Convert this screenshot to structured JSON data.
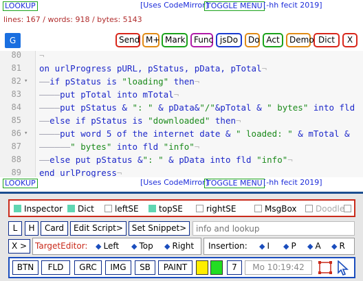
{
  "top_bar": {
    "lookup": "LOOKUP",
    "codemirror": "[Uses CodeMirror]",
    "toggle_menu": "TOGGLE MENU",
    "credit": "[-hh fecit 2019]"
  },
  "status": "lines: 167 / words: 918 / bytes: 5143",
  "toolbar": {
    "g": "G",
    "buttons": [
      {
        "label": "Send",
        "color": "#d8261a"
      },
      {
        "label": "M+",
        "color": "#e08a14"
      },
      {
        "label": "Mark",
        "color": "#1aa21a"
      },
      {
        "label": "Func",
        "color": "#b01aa8"
      },
      {
        "label": "jsDo",
        "color": "#1a3ad0"
      },
      {
        "label": "Do",
        "color": "#e08a14"
      },
      {
        "label": "Act",
        "color": "#1aa21a"
      },
      {
        "label": "Demo",
        "color": "#e08a14"
      },
      {
        "label": "Dict",
        "color": "#d8261a"
      },
      {
        "label": "X",
        "color": "#d8261a"
      }
    ]
  },
  "editor": {
    "lines": [
      {
        "num": "80",
        "fold": "",
        "code": [
          {
            "t": "eol",
            "v": "¬"
          }
        ]
      },
      {
        "num": "81",
        "fold": "",
        "code": [
          {
            "t": "kw",
            "v": "on urlProgress pURL, pStatus, pData, pTotal"
          },
          {
            "t": "eol",
            "v": "¬"
          }
        ]
      },
      {
        "num": "82",
        "fold": "▾",
        "code": [
          {
            "t": "ind",
            "v": "——"
          },
          {
            "t": "kw",
            "v": "if pStatus is "
          },
          {
            "t": "str",
            "v": "\"loading\""
          },
          {
            "t": "kw",
            "v": " then"
          },
          {
            "t": "eol",
            "v": "¬"
          }
        ]
      },
      {
        "num": "83",
        "fold": "",
        "code": [
          {
            "t": "ind",
            "v": "————"
          },
          {
            "t": "kw",
            "v": "put pTotal into mTotal"
          },
          {
            "t": "eol",
            "v": "¬"
          }
        ]
      },
      {
        "num": "84",
        "fold": "",
        "code": [
          {
            "t": "ind",
            "v": "————"
          },
          {
            "t": "kw",
            "v": "put pStatus & "
          },
          {
            "t": "str",
            "v": "\": \""
          },
          {
            "t": "kw",
            "v": " & pData&"
          },
          {
            "t": "str",
            "v": "\"/\""
          },
          {
            "t": "kw",
            "v": "&pTotal & "
          },
          {
            "t": "str",
            "v": "\" bytes\""
          },
          {
            "t": "kw",
            "v": " into fld"
          }
        ]
      },
      {
        "num": "85",
        "fold": "",
        "code": [
          {
            "t": "ind",
            "v": "——"
          },
          {
            "t": "kw",
            "v": "else if pStatus is "
          },
          {
            "t": "str",
            "v": "\"downloaded\""
          },
          {
            "t": "kw",
            "v": " then"
          },
          {
            "t": "eol",
            "v": "¬"
          }
        ]
      },
      {
        "num": "86",
        "fold": "▾",
        "code": [
          {
            "t": "ind",
            "v": "————"
          },
          {
            "t": "kw",
            "v": "put word 5 of the internet date & "
          },
          {
            "t": "str",
            "v": "\" loaded: \""
          },
          {
            "t": "kw",
            "v": " & mTotal &"
          }
        ]
      },
      {
        "num": "87",
        "fold": "",
        "code": [
          {
            "t": "ind",
            "v": "——————"
          },
          {
            "t": "str",
            "v": "\" bytes\""
          },
          {
            "t": "kw",
            "v": " into fld "
          },
          {
            "t": "str",
            "v": "\"info\""
          },
          {
            "t": "eol",
            "v": "¬"
          }
        ]
      },
      {
        "num": "88",
        "fold": "",
        "code": [
          {
            "t": "ind",
            "v": "——"
          },
          {
            "t": "kw",
            "v": "else put pStatus &"
          },
          {
            "t": "str",
            "v": "\": \""
          },
          {
            "t": "kw",
            "v": " & pData into fld "
          },
          {
            "t": "str",
            "v": "\"info\""
          },
          {
            "t": "eol",
            "v": "¬"
          }
        ]
      },
      {
        "num": "89",
        "fold": "",
        "code": [
          {
            "t": "kw",
            "v": "end urlProgress"
          },
          {
            "t": "eol",
            "v": "¬"
          }
        ]
      }
    ]
  },
  "bottom_bar": {
    "lookup": "LOOKUP",
    "codemirror": "[Uses CodeMirror]",
    "toggle_menu": "TOGGLE MENU",
    "credit": "[-hh fecit 2019]"
  },
  "panel": {
    "checks": [
      {
        "label": "Inspector",
        "on": true
      },
      {
        "label": "Dict",
        "on": true
      },
      {
        "label": "leftSE",
        "on": false
      },
      {
        "label": "topSE",
        "on": true
      },
      {
        "label": "rightSE",
        "on": false
      },
      {
        "label": "MsgBox",
        "on": false
      },
      {
        "label": "Doodle",
        "on": false
      }
    ],
    "row2": {
      "l": "L",
      "h": "H",
      "card": "Card",
      "edit_script": "Edit Script>",
      "set_snippet": "Set Snippet>",
      "info_placeholder": "info and lookup"
    },
    "row3": {
      "x": "X >",
      "target_editor": "TargetEditor:",
      "left": "Left",
      "top": "Top",
      "right": "Right",
      "insertion": "Insertion:",
      "i": "I",
      "p": "P",
      "a": "A",
      "r": "R"
    },
    "row4": {
      "btn": "BTN",
      "fld": "FLD",
      "grc": "GRC",
      "img": "IMG",
      "sb": "SB",
      "paint": "PAINT",
      "swatch1": "#ffee00",
      "swatch2": "#22dd22",
      "num": "7",
      "clock": "Mo 10:19:42"
    }
  }
}
